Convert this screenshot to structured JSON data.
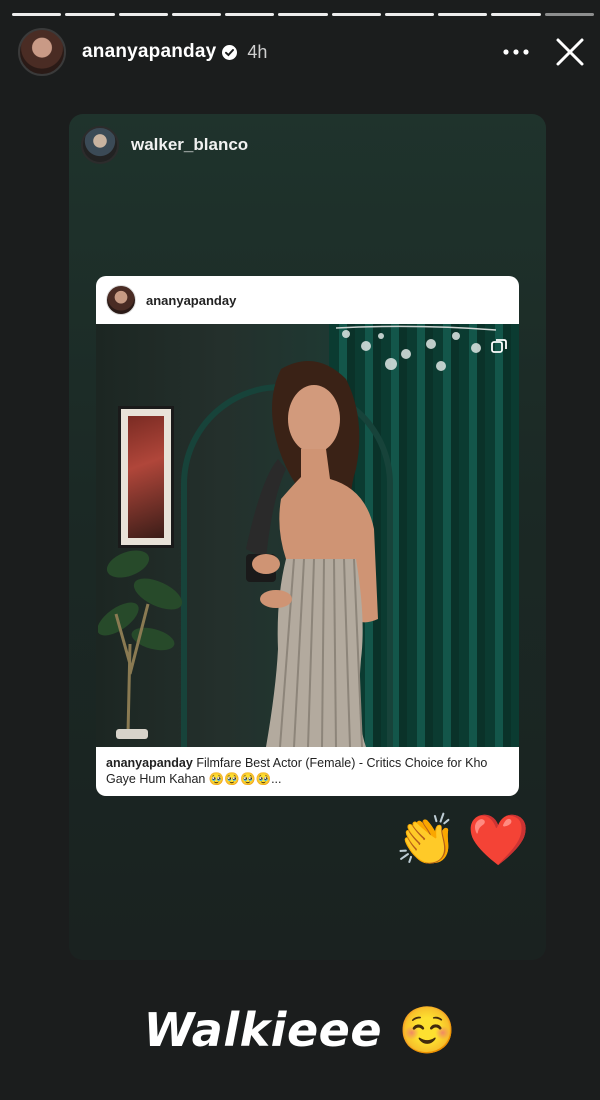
{
  "progress": {
    "segments": 11,
    "active_index": 10
  },
  "header": {
    "username": "ananyapanday",
    "verified": true,
    "time": "4h",
    "more_icon": "more-horizontal-icon",
    "close_icon": "close-icon"
  },
  "shared_card": {
    "sharer_username": "walker_blanco",
    "post": {
      "username": "ananyapanday",
      "caption_user": "ananyapanday",
      "caption_text": "Filmfare Best Actor (Female) - Critics Choice for Kho Gaye Hum Kahan 🥹🥹🥹🥹...",
      "multi_photo_icon": "carousel-icon"
    }
  },
  "stickers": {
    "clap": "👏",
    "heart": "❤️"
  },
  "story_text": {
    "text": "Walkieee",
    "emoji": "☺️"
  },
  "colors": {
    "background": "#1b1d1d",
    "card": "#1f332c",
    "curtain": "#0b3b31"
  }
}
